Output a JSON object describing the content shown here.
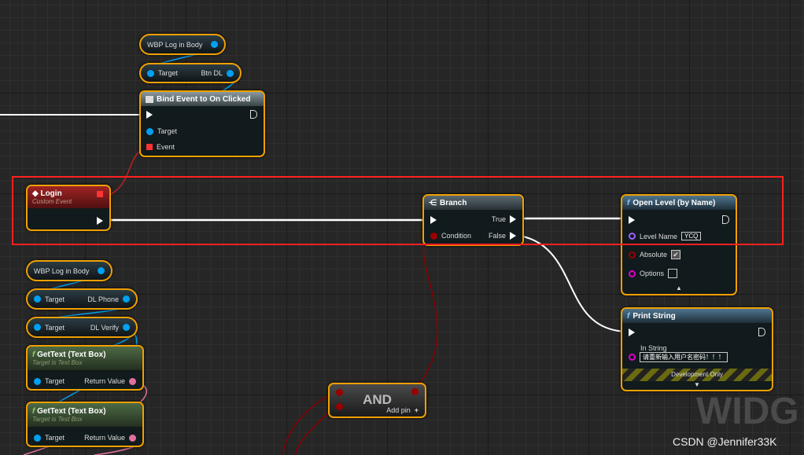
{
  "nodes": {
    "wbp_top": {
      "label": "WBP Log in Body"
    },
    "btn_dl": {
      "target": "Target",
      "out": "Btn DL"
    },
    "bind": {
      "title": "Bind Event to On Clicked",
      "target": "Target",
      "event": "Event"
    },
    "login": {
      "title": "Login",
      "subtitle": "Custom Event"
    },
    "branch": {
      "title": "Branch",
      "condition": "Condition",
      "true": "True",
      "false": "False"
    },
    "open_level": {
      "title": "Open Level (by Name)",
      "level_name": "Level Name",
      "level_value": "YCQ",
      "absolute": "Absolute",
      "absolute_checked": true,
      "options": "Options",
      "options_checked": false
    },
    "print": {
      "title": "Print String",
      "in_string": "In String",
      "value": "请重新输入用户名密码！！！",
      "dev": "Development Only"
    },
    "wbp_bottom": {
      "label": "WBP Log in Body"
    },
    "dl_phone": {
      "target": "Target",
      "out": "DL Phone"
    },
    "dl_verify": {
      "target": "Target",
      "out": "DL Verify"
    },
    "gettext1": {
      "title": "GetText (Text Box)",
      "subtitle": "Target is Text Box",
      "target": "Target",
      "ret": "Return Value"
    },
    "gettext2": {
      "title": "GetText (Text Box)",
      "subtitle": "Target is Text Box",
      "target": "Target",
      "ret": "Return Value"
    },
    "and": {
      "title": "AND",
      "add_pin": "Add pin"
    }
  },
  "watermark": "WIDG",
  "credit": "CSDN @Jennifer33K",
  "colors": {
    "selection": "#ff2020",
    "node_border": "#f0a000",
    "object_pin": "#00a0f0",
    "string_pin": "#e000d0",
    "bool_pin": "#900000",
    "text_pin": "#e070a0"
  }
}
